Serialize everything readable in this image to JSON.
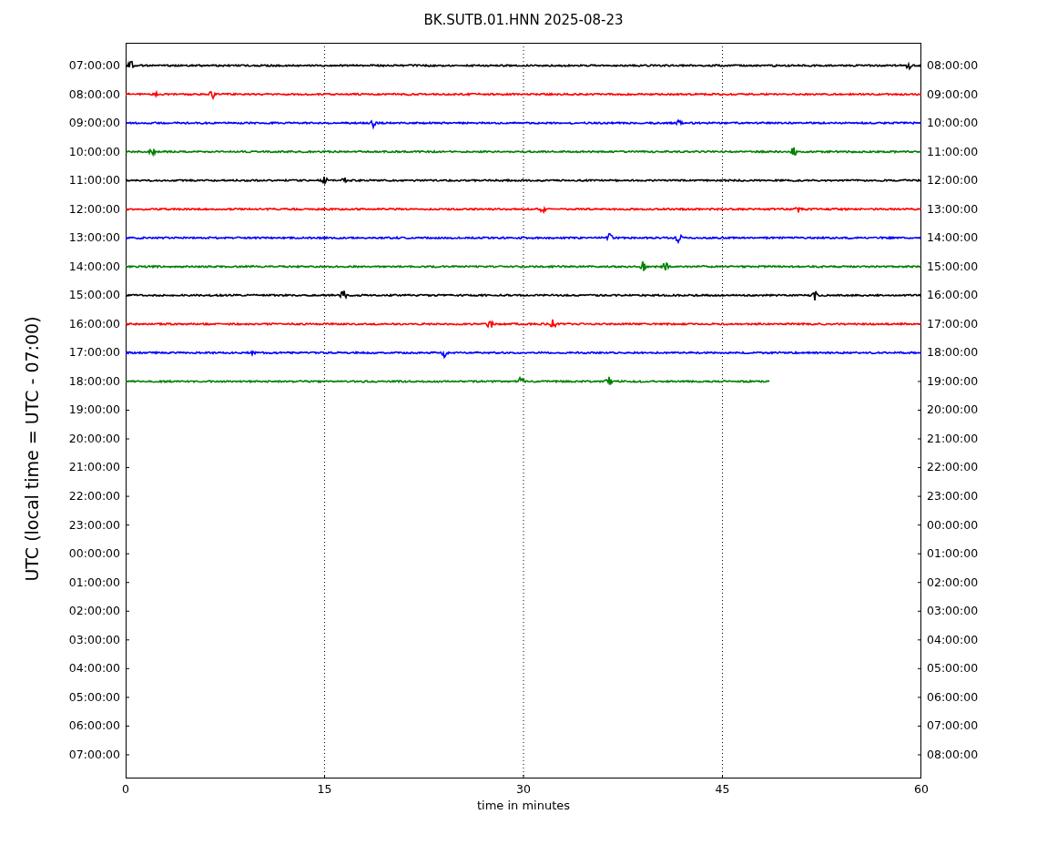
{
  "title": "BK.SUTB.01.HNN 2025-08-23",
  "ylabel": "UTC (local time = UTC - 07:00)",
  "xlabel": "time in minutes",
  "left_ticks": [
    "07:00:00",
    "08:00:00",
    "09:00:00",
    "10:00:00",
    "11:00:00",
    "12:00:00",
    "13:00:00",
    "14:00:00",
    "15:00:00",
    "16:00:00",
    "17:00:00",
    "18:00:00",
    "19:00:00",
    "20:00:00",
    "21:00:00",
    "22:00:00",
    "23:00:00",
    "00:00:00",
    "01:00:00",
    "02:00:00",
    "03:00:00",
    "04:00:00",
    "05:00:00",
    "06:00:00",
    "07:00:00"
  ],
  "right_ticks": [
    "08:00:00",
    "09:00:00",
    "10:00:00",
    "11:00:00",
    "12:00:00",
    "13:00:00",
    "14:00:00",
    "15:00:00",
    "16:00:00",
    "17:00:00",
    "18:00:00",
    "19:00:00",
    "20:00:00",
    "21:00:00",
    "22:00:00",
    "23:00:00",
    "00:00:00",
    "01:00:00",
    "02:00:00",
    "03:00:00",
    "04:00:00",
    "05:00:00",
    "06:00:00",
    "07:00:00",
    "08:00:00"
  ],
  "x_ticks": [
    "0",
    "15",
    "30",
    "45",
    "60"
  ],
  "traces": [
    {
      "color": "#000000",
      "level": 1
    },
    {
      "color": "#ff0000",
      "level": 1
    },
    {
      "color": "#0000ff",
      "level": 1
    },
    {
      "color": "#008000",
      "level": 1
    },
    {
      "color": "#000000",
      "level": 1
    },
    {
      "color": "#ff0000",
      "level": 1
    },
    {
      "color": "#0000ff",
      "level": 1
    },
    {
      "color": "#008000",
      "level": 1
    },
    {
      "color": "#000000",
      "level": 1
    },
    {
      "color": "#ff0000",
      "level": 1
    },
    {
      "color": "#0000ff",
      "level": 1
    },
    {
      "color": "#008000",
      "level": 0.81
    }
  ]
}
